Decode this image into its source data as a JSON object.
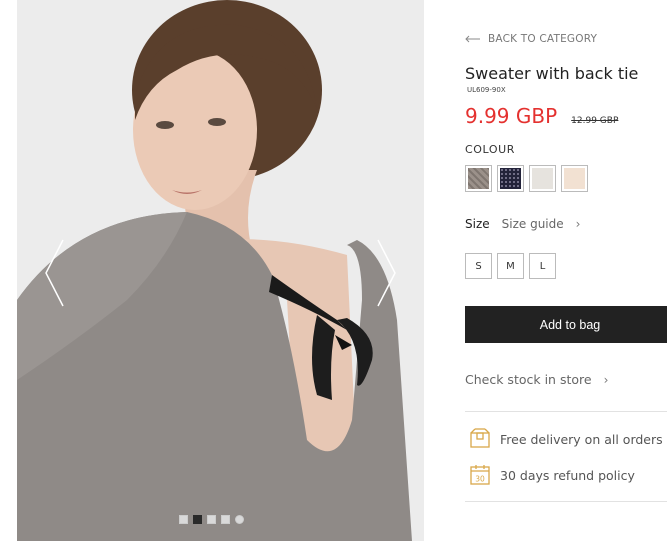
{
  "gallery": {
    "prev_icon": "chevron-left-icon",
    "next_icon": "chevron-right-icon",
    "dot_count": 5,
    "active_dot": 1
  },
  "product": {
    "back_label": "BACK TO CATEGORY",
    "title": "Sweater with back tie",
    "sku": "UL609-90X",
    "price": "9.99 GBP",
    "old_price": "12.99 GBP",
    "price_color": "#e4312f"
  },
  "colour": {
    "label": "COLOUR",
    "swatches": [
      {
        "name": "grey-melange",
        "color": "#8e847e"
      },
      {
        "name": "navy-glitter",
        "color": "#2a2a3c"
      },
      {
        "name": "light-grey",
        "color": "#e6e3de"
      },
      {
        "name": "cream",
        "color": "#f2e1d2"
      }
    ]
  },
  "size": {
    "label": "Size",
    "guide_label": "Size guide",
    "options": [
      "S",
      "M",
      "L"
    ]
  },
  "actions": {
    "add_to_bag": "Add to bag",
    "check_stock": "Check stock in store"
  },
  "features": {
    "delivery": "Free delivery on all orders",
    "refund": "30 days refund policy",
    "refund_icon_text": "30",
    "accent": "#d9a84a"
  }
}
